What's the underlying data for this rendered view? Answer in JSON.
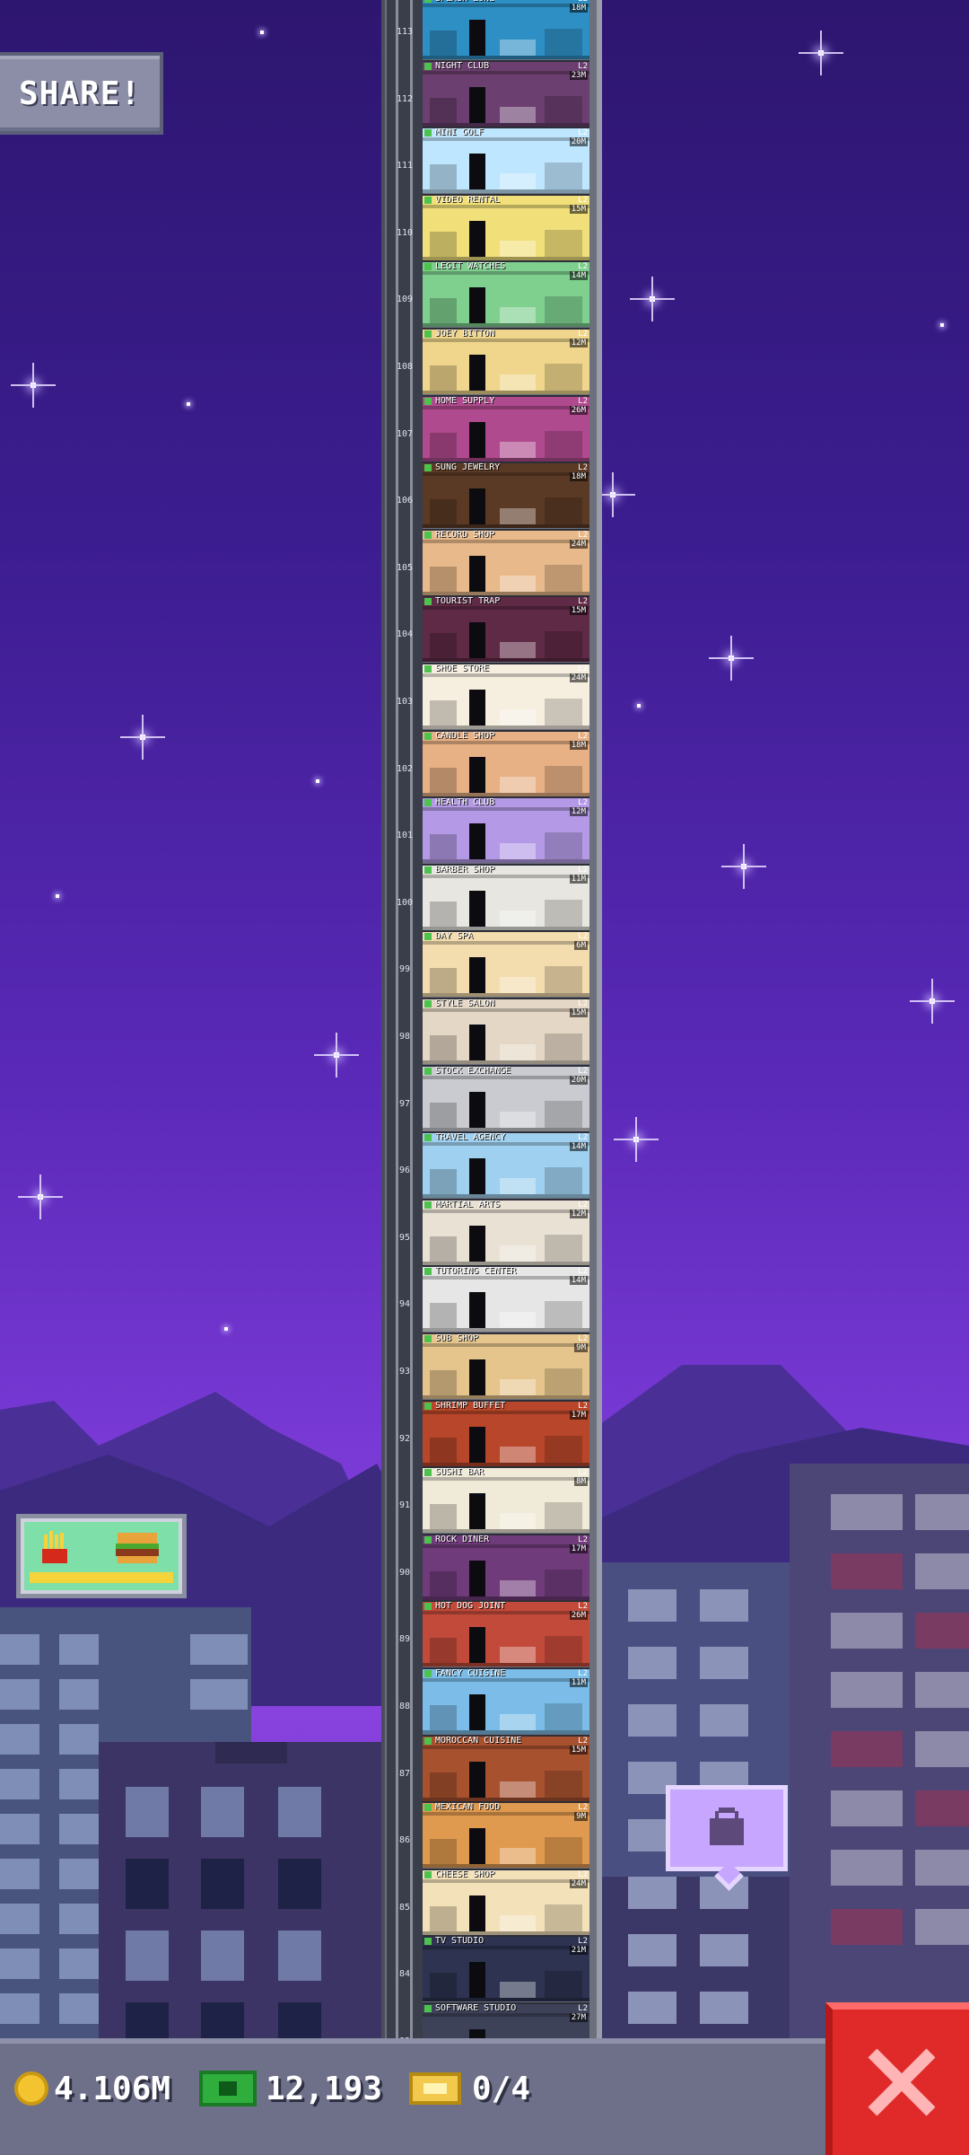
{
  "share_button": {
    "label": "SHARE!"
  },
  "resources": {
    "coins": "4.106M",
    "bux": "12,193",
    "tickets": "0/4"
  },
  "colors": {
    "sky_top": "#2d1670",
    "sky_mid": "#7a3ad6",
    "close_button": "#e02a2a",
    "bottom_bar": "#6d7088"
  },
  "icons": {
    "coin": "coin-icon",
    "bux": "bux-icon",
    "ticket": "ticket-icon",
    "close": "close-icon",
    "bag": "bag-icon"
  },
  "floors": [
    {
      "num": "113",
      "name": "SPLASH ZONE",
      "level": "L2",
      "time": "18M",
      "bg": "#2e8fc4"
    },
    {
      "num": "112",
      "name": "NIGHT CLUB",
      "level": "L2",
      "time": "23M",
      "bg": "#6b3f6f"
    },
    {
      "num": "111",
      "name": "MINI GOLF",
      "level": "L2",
      "time": "20M",
      "bg": "#bfe6ff"
    },
    {
      "num": "110",
      "name": "VIDEO RENTAL",
      "level": "L2",
      "time": "15M",
      "bg": "#f1e07a"
    },
    {
      "num": "109",
      "name": "LEGIT WATCHES",
      "level": "L2",
      "time": "14M",
      "bg": "#7fd08f"
    },
    {
      "num": "108",
      "name": "JOEY BITTON",
      "level": "L2",
      "time": "12M",
      "bg": "#f0d68c"
    },
    {
      "num": "107",
      "name": "HOME SUPPLY",
      "level": "L2",
      "time": "26M",
      "bg": "#b04a8e"
    },
    {
      "num": "106",
      "name": "SUNG JEWELRY",
      "level": "L2",
      "time": "18M",
      "bg": "#5b3a25"
    },
    {
      "num": "105",
      "name": "RECORD SHOP",
      "level": "L2",
      "time": "24M",
      "bg": "#e8b98a"
    },
    {
      "num": "104",
      "name": "TOURIST TRAP",
      "level": "L2",
      "time": "15M",
      "bg": "#5e2a46"
    },
    {
      "num": "103",
      "name": "SHOE STORE",
      "level": "L2",
      "time": "24M",
      "bg": "#f6efe0"
    },
    {
      "num": "102",
      "name": "CANDLE SHOP",
      "level": "L2",
      "time": "18M",
      "bg": "#e7b085"
    },
    {
      "num": "101",
      "name": "HEALTH CLUB",
      "level": "L2",
      "time": "12M",
      "bg": "#b49ae6"
    },
    {
      "num": "100",
      "name": "BARBER SHOP",
      "level": "L2",
      "time": "11M",
      "bg": "#e7e6e0"
    },
    {
      "num": "99",
      "name": "DAY SPA",
      "level": "L2",
      "time": "6M",
      "bg": "#f3dcae"
    },
    {
      "num": "98",
      "name": "STYLE SALON",
      "level": "L2",
      "time": "15M",
      "bg": "#e5d7c5"
    },
    {
      "num": "97",
      "name": "STOCK EXCHANGE",
      "level": "L2",
      "time": "20M",
      "bg": "#c9cbd0"
    },
    {
      "num": "96",
      "name": "TRAVEL AGENCY",
      "level": "L2",
      "time": "14M",
      "bg": "#9fd0ef"
    },
    {
      "num": "95",
      "name": "MARTIAL ARTS",
      "level": "L2",
      "time": "12M",
      "bg": "#e9e1d4"
    },
    {
      "num": "94",
      "name": "TUTORING CENTER",
      "level": "L2",
      "time": "14M",
      "bg": "#e6e6e6"
    },
    {
      "num": "93",
      "name": "SUB SHOP",
      "level": "L2",
      "time": "9M",
      "bg": "#e6c58c"
    },
    {
      "num": "92",
      "name": "SHRIMP BUFFET",
      "level": "L2",
      "time": "17M",
      "bg": "#b7462a"
    },
    {
      "num": "91",
      "name": "SUSHI BAR",
      "level": "L2",
      "time": "8M",
      "bg": "#f0ead8"
    },
    {
      "num": "90",
      "name": "ROCK DINER",
      "level": "L2",
      "time": "17M",
      "bg": "#6f3b7a"
    },
    {
      "num": "89",
      "name": "HOT DOG JOINT",
      "level": "L2",
      "time": "26M",
      "bg": "#c24a3a"
    },
    {
      "num": "88",
      "name": "FANCY CUISINE",
      "level": "L2",
      "time": "11M",
      "bg": "#7bbde8"
    },
    {
      "num": "87",
      "name": "MOROCCAN CUISINE",
      "level": "L2",
      "time": "15M",
      "bg": "#a7512f"
    },
    {
      "num": "86",
      "name": "MEXICAN FOOD",
      "level": "L2",
      "time": "9M",
      "bg": "#e09a4f"
    },
    {
      "num": "85",
      "name": "CHEESE SHOP",
      "level": "L2",
      "time": "24M",
      "bg": "#f3e1b9"
    },
    {
      "num": "84",
      "name": "TV STUDIO",
      "level": "L2",
      "time": "21M",
      "bg": "#2d3350"
    },
    {
      "num": "83",
      "name": "SOFTWARE STUDIO",
      "level": "L2",
      "time": "27M",
      "bg": "#3d4258"
    }
  ]
}
